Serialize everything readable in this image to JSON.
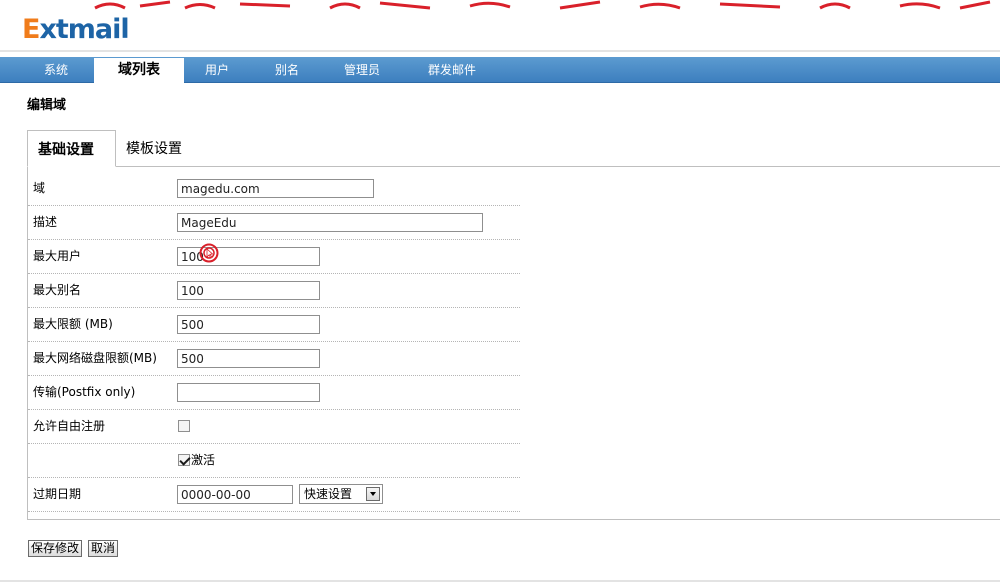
{
  "logo": {
    "first": "E",
    "rest": "xtmail"
  },
  "nav": {
    "items": [
      {
        "label": "系统",
        "active": false
      },
      {
        "label": "域列表",
        "active": true
      },
      {
        "label": "用户",
        "active": false
      },
      {
        "label": "别名",
        "active": false
      },
      {
        "label": "管理员",
        "active": false
      },
      {
        "label": "群发邮件",
        "active": false
      }
    ]
  },
  "page": {
    "title": "编辑域"
  },
  "tabs": [
    {
      "label": "基础设置",
      "active": true
    },
    {
      "label": "模板设置",
      "active": false
    }
  ],
  "form": {
    "domain": {
      "label": "域",
      "value": "magedu.com"
    },
    "description": {
      "label": "描述",
      "value": "MageEdu"
    },
    "max_users": {
      "label": "最大用户",
      "value": "100"
    },
    "max_aliases": {
      "label": "最大别名",
      "value": "100"
    },
    "max_quota": {
      "label": "最大限额 (MB)",
      "value": "500"
    },
    "max_netdisk": {
      "label": "最大网络磁盘限额(MB)",
      "value": "500"
    },
    "transport": {
      "label": "传输(Postfix only)",
      "value": ""
    },
    "allow_signup": {
      "label": "允许自由注册",
      "checked": false
    },
    "active": {
      "label": "激活",
      "checked": true
    },
    "expire": {
      "label": "过期日期",
      "value": "0000-00-00",
      "quick_select": "快速设置"
    }
  },
  "buttons": {
    "save": "保存修改",
    "cancel": "取消"
  },
  "colors": {
    "nav_bg": "#4a8ac8",
    "logo_orange": "#f07c1b",
    "logo_blue": "#1d64a6",
    "cursor_red": "#d9202a"
  }
}
